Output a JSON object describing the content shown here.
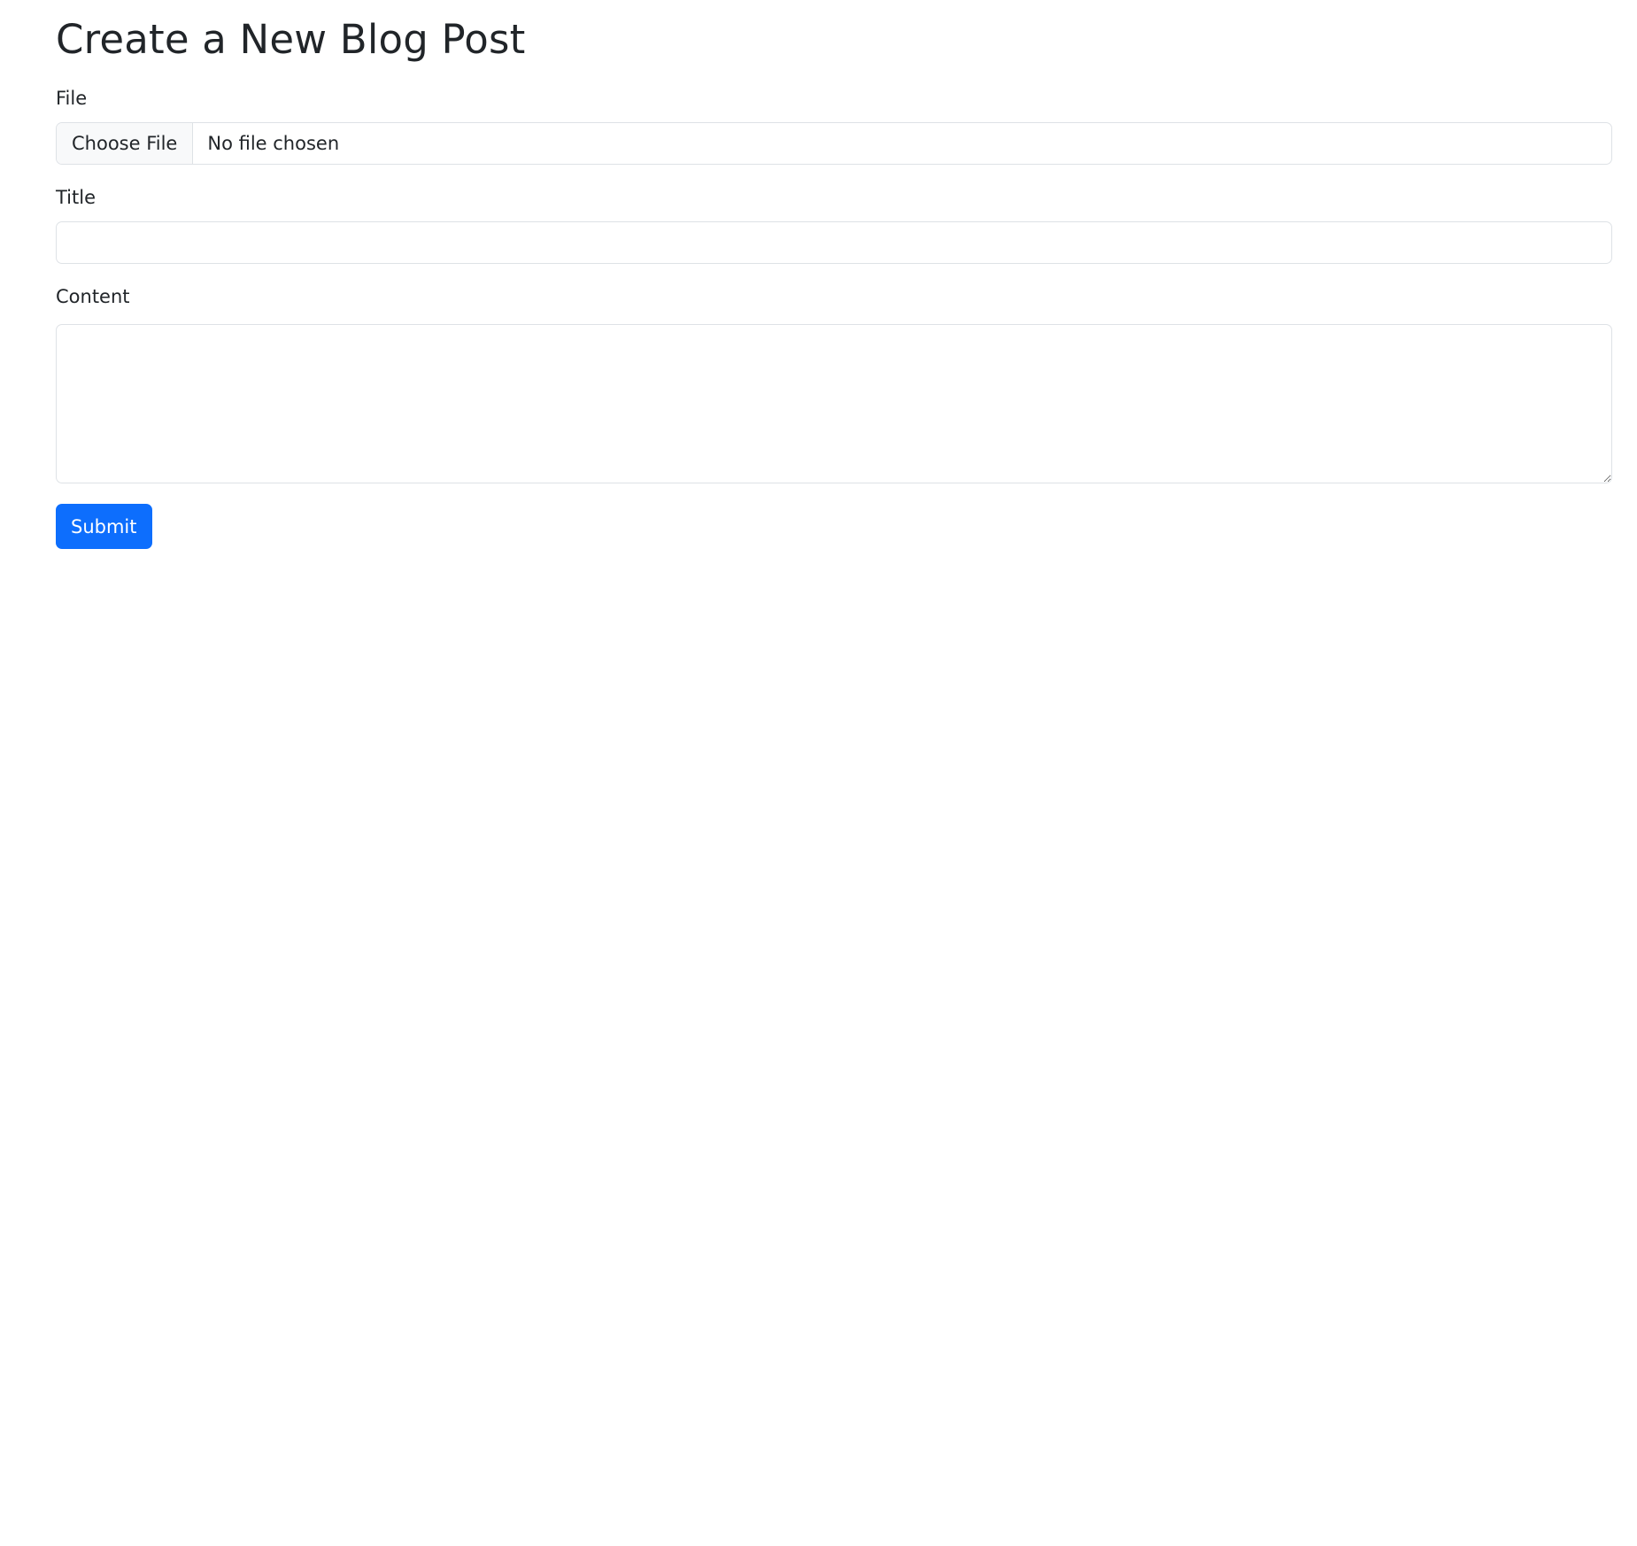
{
  "page": {
    "title": "Create a New Blog Post"
  },
  "form": {
    "file": {
      "label": "File",
      "button_label": "Choose File",
      "status_text": "No file chosen"
    },
    "title": {
      "label": "Title",
      "value": "",
      "placeholder": ""
    },
    "content": {
      "label": "Content",
      "value": "",
      "placeholder": ""
    },
    "submit_label": "Submit"
  },
  "colors": {
    "primary": "#0d6efd",
    "text": "#212529",
    "border": "#dee2e6",
    "file_button_bg": "#f8f9fa"
  }
}
